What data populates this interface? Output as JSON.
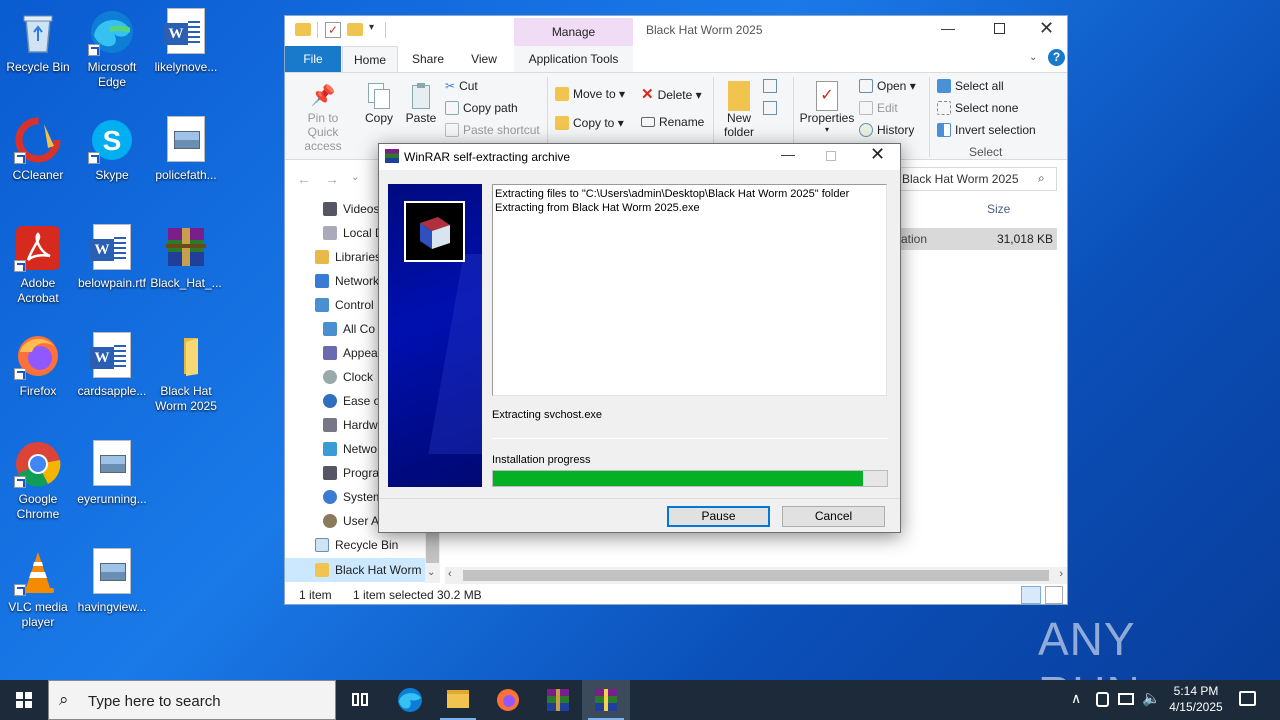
{
  "desktop": {
    "icons": [
      {
        "label": "Recycle Bin"
      },
      {
        "label": "Microsoft Edge"
      },
      {
        "label": "likelynove..."
      },
      {
        "label": "CCleaner"
      },
      {
        "label": "Skype"
      },
      {
        "label": "policefath..."
      },
      {
        "label": "Adobe Acrobat"
      },
      {
        "label": "belowpain.rtf"
      },
      {
        "label": "Black_Hat_..."
      },
      {
        "label": "Firefox"
      },
      {
        "label": "cardsapple..."
      },
      {
        "label": "Black Hat Worm 2025"
      },
      {
        "label": "Google Chrome"
      },
      {
        "label": "eyerunning..."
      },
      {
        "label": "VLC media player"
      },
      {
        "label": "havingview..."
      }
    ],
    "watermark": "ANY RUN"
  },
  "explorer": {
    "title": "Black Hat Worm 2025",
    "manage_tab": "Manage",
    "tabs": [
      "File",
      "Home",
      "Share",
      "View",
      "Application Tools"
    ],
    "ribbon": {
      "pin": "Pin to Quick access",
      "pin_l1": "Pin to Quick",
      "pin_l2": "access",
      "copy": "Copy",
      "paste": "Paste",
      "cut": "Cut",
      "copy_path": "Copy path",
      "paste_shortcut": "Paste shortcut",
      "move_to": "Move to",
      "copy_to": "Copy to",
      "delete": "Delete",
      "rename": "Rename",
      "new_folder_l1": "New",
      "new_folder_l2": "folder",
      "properties": "Properties",
      "open": "Open",
      "edit": "Edit",
      "history": "History",
      "select_all": "Select all",
      "select_none": "Select none",
      "invert_selection": "Invert selection",
      "select_group": "Select"
    },
    "search_text": "Black Hat Worm 2025",
    "column_size": "Size",
    "file_row": {
      "type_partial": "ation",
      "size": "31,018 KB"
    },
    "tree": [
      "Videos",
      "Local D",
      "Libraries",
      "Network",
      "Control",
      "All Co",
      "Appea",
      "Clock",
      "Ease o",
      "Hardw",
      "Netwo",
      "Progra",
      "System",
      "User A",
      "Recycle Bin",
      "Black Hat Worm"
    ],
    "status": {
      "items": "1 item",
      "selected": "1 item selected",
      "size": "30.2 MB"
    }
  },
  "winrar": {
    "title": "WinRAR self-extracting archive",
    "log_line1": "Extracting files to \"C:\\Users\\admin\\Desktop\\Black Hat Worm 2025\" folder",
    "log_line2": "Extracting from Black Hat Worm 2025.exe",
    "current": "Extracting svchost.exe",
    "progress_label": "Installation progress",
    "progress": 0.94,
    "pause": "Pause",
    "cancel": "Cancel"
  },
  "taskbar": {
    "search_placeholder": "Type here to search",
    "time": "5:14 PM",
    "date": "4/15/2025"
  },
  "colors": {
    "accent": "#0078d7",
    "progress": "#06b025",
    "manage_tab": "#f0dcf4",
    "winrar_banner": "#000a80"
  }
}
